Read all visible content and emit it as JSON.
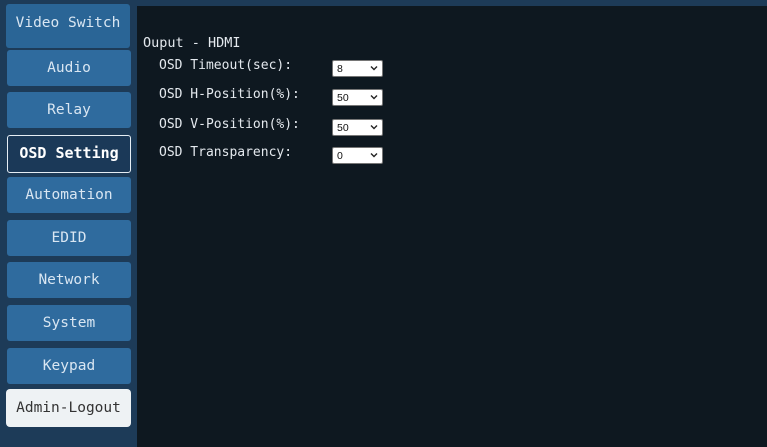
{
  "sidebar": {
    "items": [
      {
        "label": "Video Switch"
      },
      {
        "label": "Audio"
      },
      {
        "label": "Relay"
      },
      {
        "label": "OSD Setting"
      },
      {
        "label": "Automation"
      },
      {
        "label": "EDID"
      },
      {
        "label": "Network"
      },
      {
        "label": "System"
      },
      {
        "label": "Keypad"
      },
      {
        "label": "Admin-Logout"
      }
    ],
    "active": "OSD Setting"
  },
  "main": {
    "section_title": "Ouput - HDMI",
    "settings": [
      {
        "label": "OSD Timeout(sec):",
        "value": "8"
      },
      {
        "label": "OSD H-Position(%):",
        "value": "50"
      },
      {
        "label": "OSD V-Position(%):",
        "value": "50"
      },
      {
        "label": "OSD Transparency:",
        "value": "0"
      }
    ]
  },
  "icons": {
    "dropdown": "chevron-down-icon"
  },
  "colors": {
    "sidebar_bg": "#1d3b58",
    "button_bg": "#2f6b9e",
    "active_bg": "#1b3958",
    "content_bg": "#0e1820",
    "logout_bg": "#eef2f4"
  }
}
